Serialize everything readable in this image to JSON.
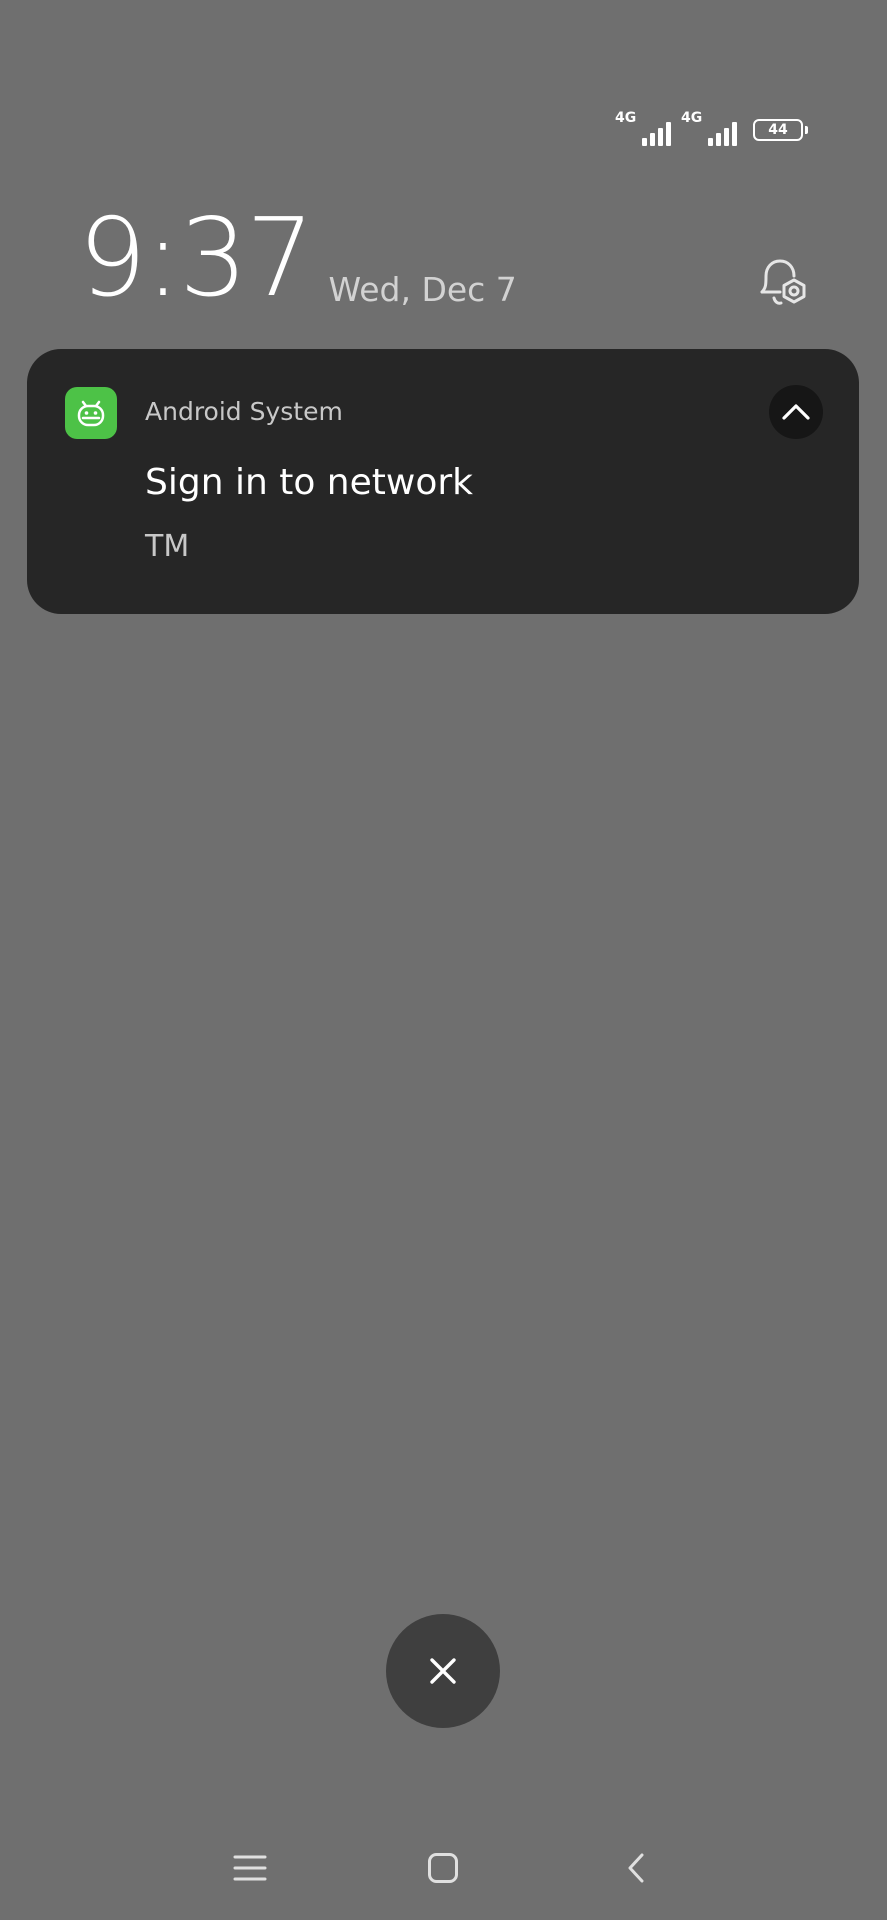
{
  "status_bar": {
    "sim1_network": "4G",
    "sim2_network": "4G",
    "battery_level": "44"
  },
  "lockscreen": {
    "time": "9:37",
    "date": "Wed, Dec 7"
  },
  "notification": {
    "app_name": "Android System",
    "title": "Sign in to network",
    "text": "TM",
    "icon_color": "#4dc247"
  },
  "icons": {
    "notification_settings": "bell-gear-icon",
    "app": "android-icon",
    "collapse": "chevron-up-icon",
    "clear": "close-icon",
    "nav_menu": "menu-icon",
    "nav_home": "home-icon",
    "nav_back": "back-icon"
  }
}
